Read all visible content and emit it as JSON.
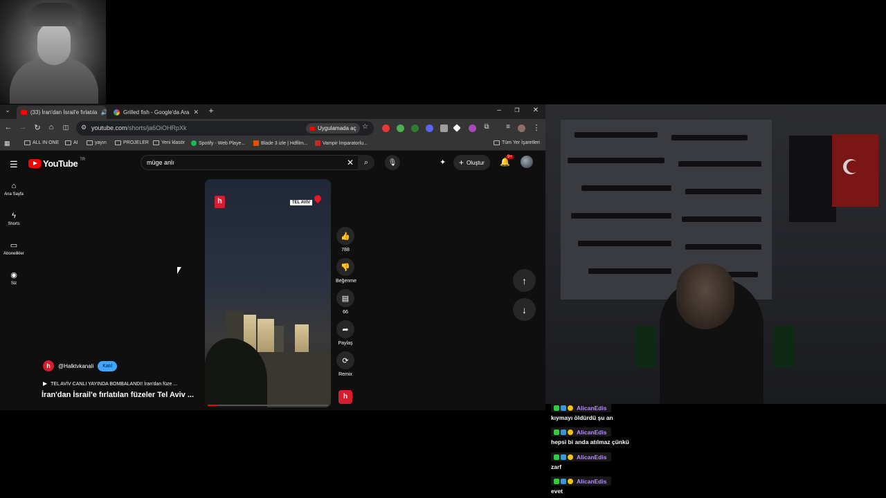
{
  "browser": {
    "tabs": [
      {
        "title": "(33) İran'dan İsrail'e fırlatıla",
        "active": true
      },
      {
        "title": "Grilled fish - Google'da Ara",
        "active": false
      }
    ],
    "new_tab": "+",
    "window_controls": {
      "minimize": "–",
      "restore": "❐",
      "close": "✕"
    },
    "url_host": "youtube.com",
    "url_path": "/shorts/ja6OiOHRpXk",
    "open_in_app": "Uygulamada aç",
    "bookmarks": [
      {
        "label": "ALL IN ONE",
        "icon": "folder-icon"
      },
      {
        "label": "AI",
        "icon": "folder-icon"
      },
      {
        "label": "yayın",
        "icon": "folder-icon"
      },
      {
        "label": "PROJELER",
        "icon": "folder-icon"
      },
      {
        "label": "Yeni klasör",
        "icon": "folder-icon"
      },
      {
        "label": "Spotify - Web Playe...",
        "icon": "spotify-icon"
      },
      {
        "label": "Blade 3 izle | Hdfilm...",
        "icon": "site-icon"
      },
      {
        "label": "Vampir İmparatorlu...",
        "icon": "site-icon"
      }
    ],
    "all_bookmarks": "Tüm Yer İşaretleri"
  },
  "youtube": {
    "logo": "YouTube",
    "region": "TR",
    "search_value": "müge anlı",
    "create_label": "Oluştur",
    "notifications_badge": "9+",
    "sidebar": [
      {
        "label": "Ana Sayfa",
        "icon": "home-icon"
      },
      {
        "label": "Shorts",
        "icon": "shorts-icon"
      },
      {
        "label": "Abonelikler",
        "icon": "subscriptions-icon"
      },
      {
        "label": "Siz",
        "icon": "you-icon"
      }
    ],
    "actions": {
      "like_count": "788",
      "dislike_label": "Beğenme",
      "comment_count": "66",
      "share_label": "Paylaş",
      "remix_label": "Remix"
    },
    "video": {
      "overlay_location": "TEL AVİV",
      "channel_logo_letter": "h",
      "progress": 0.08
    },
    "channel": {
      "handle": "@Halktvkanali",
      "join_label": "Katıl"
    },
    "music_line": "TEL AVİV CANLI YAYINDA BOMBALANDI! İran'dan füze ...",
    "title": "İran'dan İsrail'e fırlatılan füzeler Tel Aviv ..."
  },
  "chat": [
    {
      "user": "AlicanEdis",
      "message": "kıymayı öldürdü şu an"
    },
    {
      "user": "AlicanEdis",
      "message": "hepsi bi anda atılmaz çünkü"
    },
    {
      "user": "AlicanEdis",
      "message": "zarf"
    },
    {
      "user": "AlicanEdis",
      "message": "evet"
    }
  ],
  "colors": {
    "youtube_red": "#ff0000",
    "join_blue": "#3ea6ff",
    "chat_name": "#b88cff",
    "brand_red": "#d61d2e"
  }
}
